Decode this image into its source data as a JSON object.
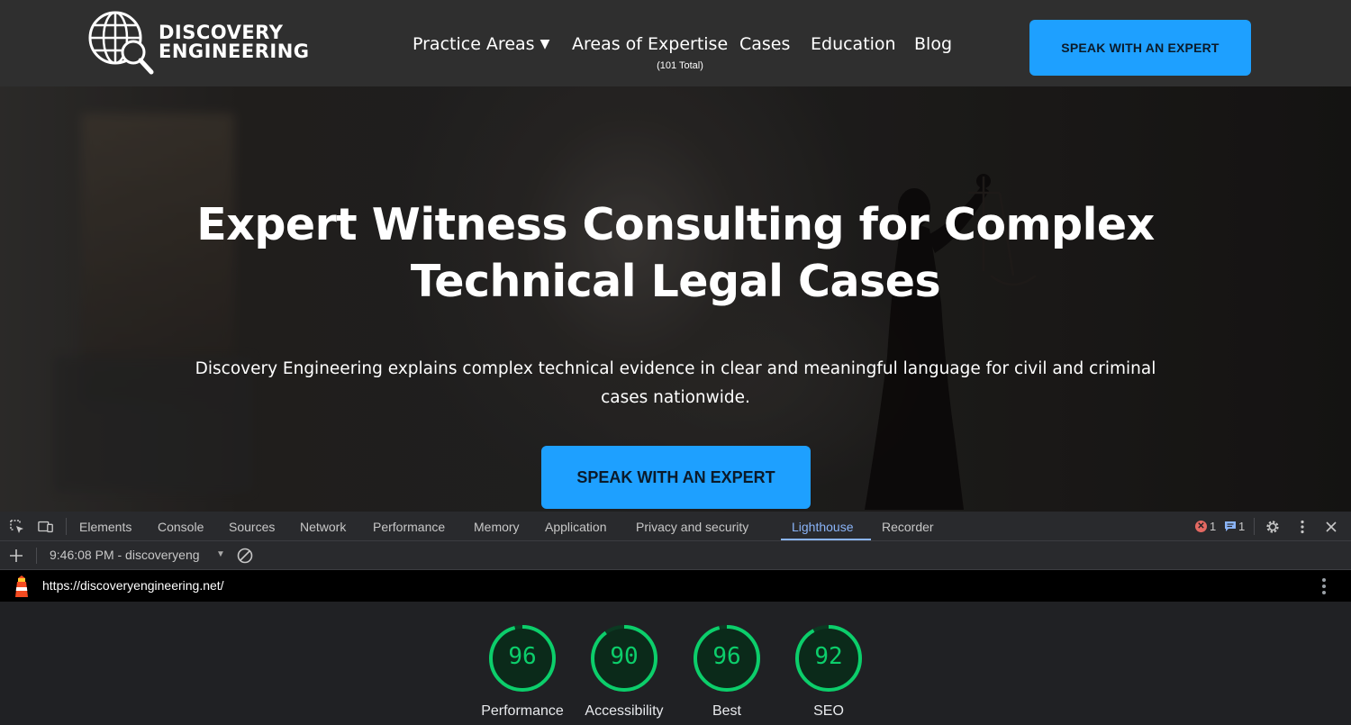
{
  "site": {
    "logo": {
      "line1": "DISCOVERY",
      "line2": "ENGINEERING"
    },
    "nav": {
      "items": [
        {
          "label": "Practice Areas"
        },
        {
          "label": "Areas of Expertise",
          "sub": "(101 Total)"
        },
        {
          "label": "Cases"
        },
        {
          "label": "Education"
        },
        {
          "label": "Blog"
        }
      ],
      "cta": "SPEAK WITH AN EXPERT"
    },
    "hero": {
      "title_line1": "Expert Witness Consulting for Complex",
      "title_line2": "Technical Legal Cases",
      "description_line1": "Discovery Engineering explains complex technical evidence in clear and meaningful language for civil and criminal",
      "description_line2": "cases nationwide.",
      "cta": "SPEAK WITH AN EXPERT"
    }
  },
  "devtools": {
    "tabs": [
      "Elements",
      "Console",
      "Sources",
      "Network",
      "Performance",
      "Memory",
      "Application",
      "Privacy and security",
      "Lighthouse",
      "Recorder"
    ],
    "active_tab": "Lighthouse",
    "error_count": "1",
    "message_count": "1",
    "report_selector": "9:46:08 PM - discoveryeng",
    "url": "https://discoveryengineering.net/",
    "scores": [
      {
        "label": "Performance",
        "value": 96
      },
      {
        "label": "Accessibility",
        "value": 90
      },
      {
        "label": "Best",
        "value": 96
      },
      {
        "label": "SEO",
        "value": 92
      }
    ],
    "colors": {
      "pass": "#0cce6b",
      "accent": "#8ab4f8",
      "cta": "#1ea0ff"
    }
  }
}
